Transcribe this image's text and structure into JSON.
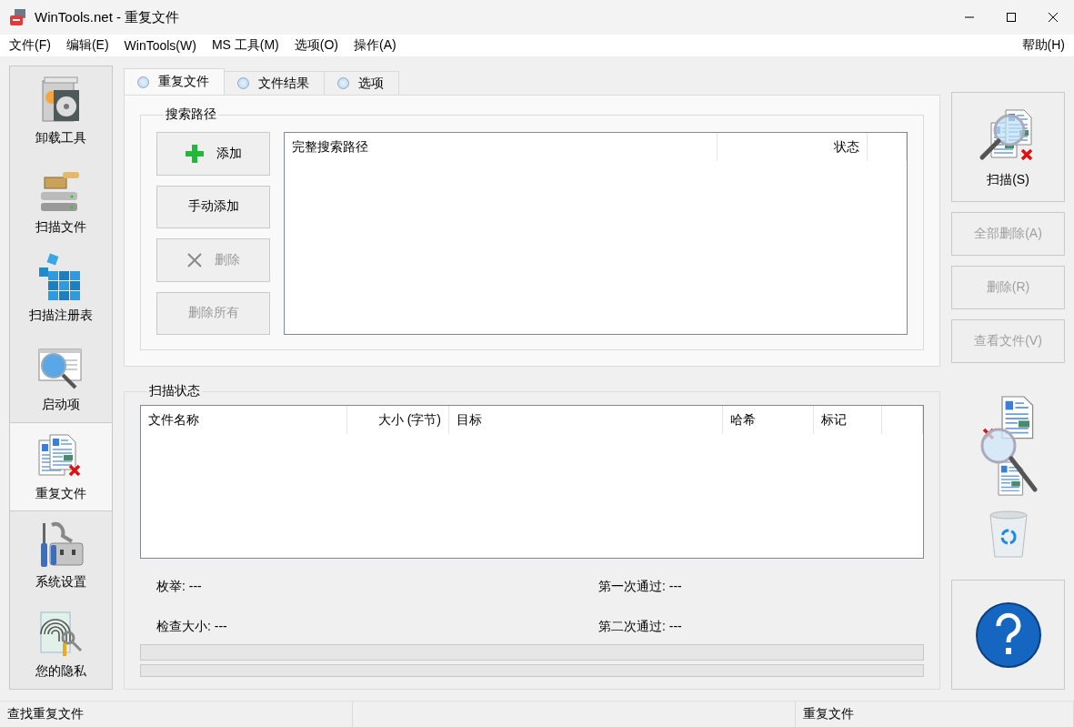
{
  "window": {
    "title": "WinTools.net - 重复文件"
  },
  "menu": {
    "items": [
      "文件(F)",
      "编辑(E)",
      "WinTools(W)",
      "MS 工具(M)",
      "选项(O)",
      "操作(A)"
    ],
    "help": "帮助(H)"
  },
  "sidebar": {
    "items": [
      {
        "label": "卸载工具",
        "kind": "uninstall",
        "selected": false
      },
      {
        "label": "扫描文件",
        "kind": "scanfiles",
        "selected": false
      },
      {
        "label": "扫描注册表",
        "kind": "registry",
        "selected": false
      },
      {
        "label": "启动项",
        "kind": "startup",
        "selected": false
      },
      {
        "label": "重复文件",
        "kind": "duplicates",
        "selected": true
      },
      {
        "label": "系统设置",
        "kind": "settings",
        "selected": false
      },
      {
        "label": "您的隐私",
        "kind": "privacy",
        "selected": false
      }
    ]
  },
  "tabs": [
    {
      "label": "重复文件",
      "selected": true
    },
    {
      "label": "文件结果",
      "selected": false
    },
    {
      "label": "选项",
      "selected": false
    }
  ],
  "search_paths": {
    "title": "搜索路径",
    "buttons": [
      {
        "label": "添加",
        "kind": "add",
        "disabled": false
      },
      {
        "label": "手动添加",
        "kind": "plain",
        "disabled": false
      },
      {
        "label": "删除",
        "kind": "remove",
        "disabled": true
      },
      {
        "label": "删除所有",
        "kind": "plain",
        "disabled": true
      }
    ],
    "columns": [
      "完整搜索路径",
      "状态"
    ]
  },
  "scan_status": {
    "title": "扫描状态",
    "columns": [
      "文件名称",
      "大小 (字节)",
      "目标",
      "哈希",
      "标记"
    ],
    "stats": [
      "枚举: ---",
      "第一次通过: ---",
      "检查大小: ---",
      "第二次通过: ---"
    ],
    "progress": [
      {
        "level": 0
      },
      {
        "level": 0
      }
    ]
  },
  "actions": [
    {
      "label": "扫描(S)",
      "kind": "scan",
      "disabled": false
    },
    {
      "label": "全部删除(A)",
      "kind": "plain",
      "disabled": true
    },
    {
      "label": "删除(R)",
      "kind": "plain",
      "disabled": true
    },
    {
      "label": "查看文件(V)",
      "kind": "plain",
      "disabled": true
    }
  ],
  "status_bar": {
    "left": "查找重复文件",
    "right": "重复文件"
  }
}
